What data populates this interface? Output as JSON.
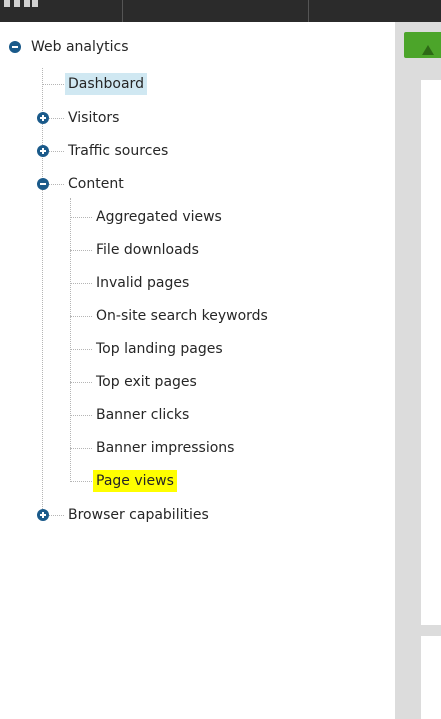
{
  "tree": {
    "root": {
      "label": "Web analytics",
      "expanded": true,
      "icon": "minus-circle-icon"
    },
    "items": [
      {
        "label": "Dashboard",
        "selected": true
      },
      {
        "label": "Visitors",
        "expandable": true,
        "expanded": false
      },
      {
        "label": "Traffic sources",
        "expandable": true,
        "expanded": false
      },
      {
        "label": "Content",
        "expandable": true,
        "expanded": true,
        "children": [
          {
            "label": "Aggregated views"
          },
          {
            "label": "File downloads"
          },
          {
            "label": "Invalid pages"
          },
          {
            "label": "On-site search keywords"
          },
          {
            "label": "Top landing pages"
          },
          {
            "label": "Top exit pages"
          },
          {
            "label": "Banner clicks"
          },
          {
            "label": "Banner impressions"
          },
          {
            "label": "Page views",
            "highlighted": true
          }
        ]
      },
      {
        "label": "Browser capabilities",
        "expandable": true,
        "expanded": false
      }
    ]
  },
  "colors": {
    "topbar": "#2b2b2b",
    "node_icon": "#1a5a8a",
    "selected_bg": "#d0e8f2",
    "highlight_bg": "#ffff00",
    "accent_green": "#4ca52a",
    "panel_bg": "#dcdcdc"
  }
}
